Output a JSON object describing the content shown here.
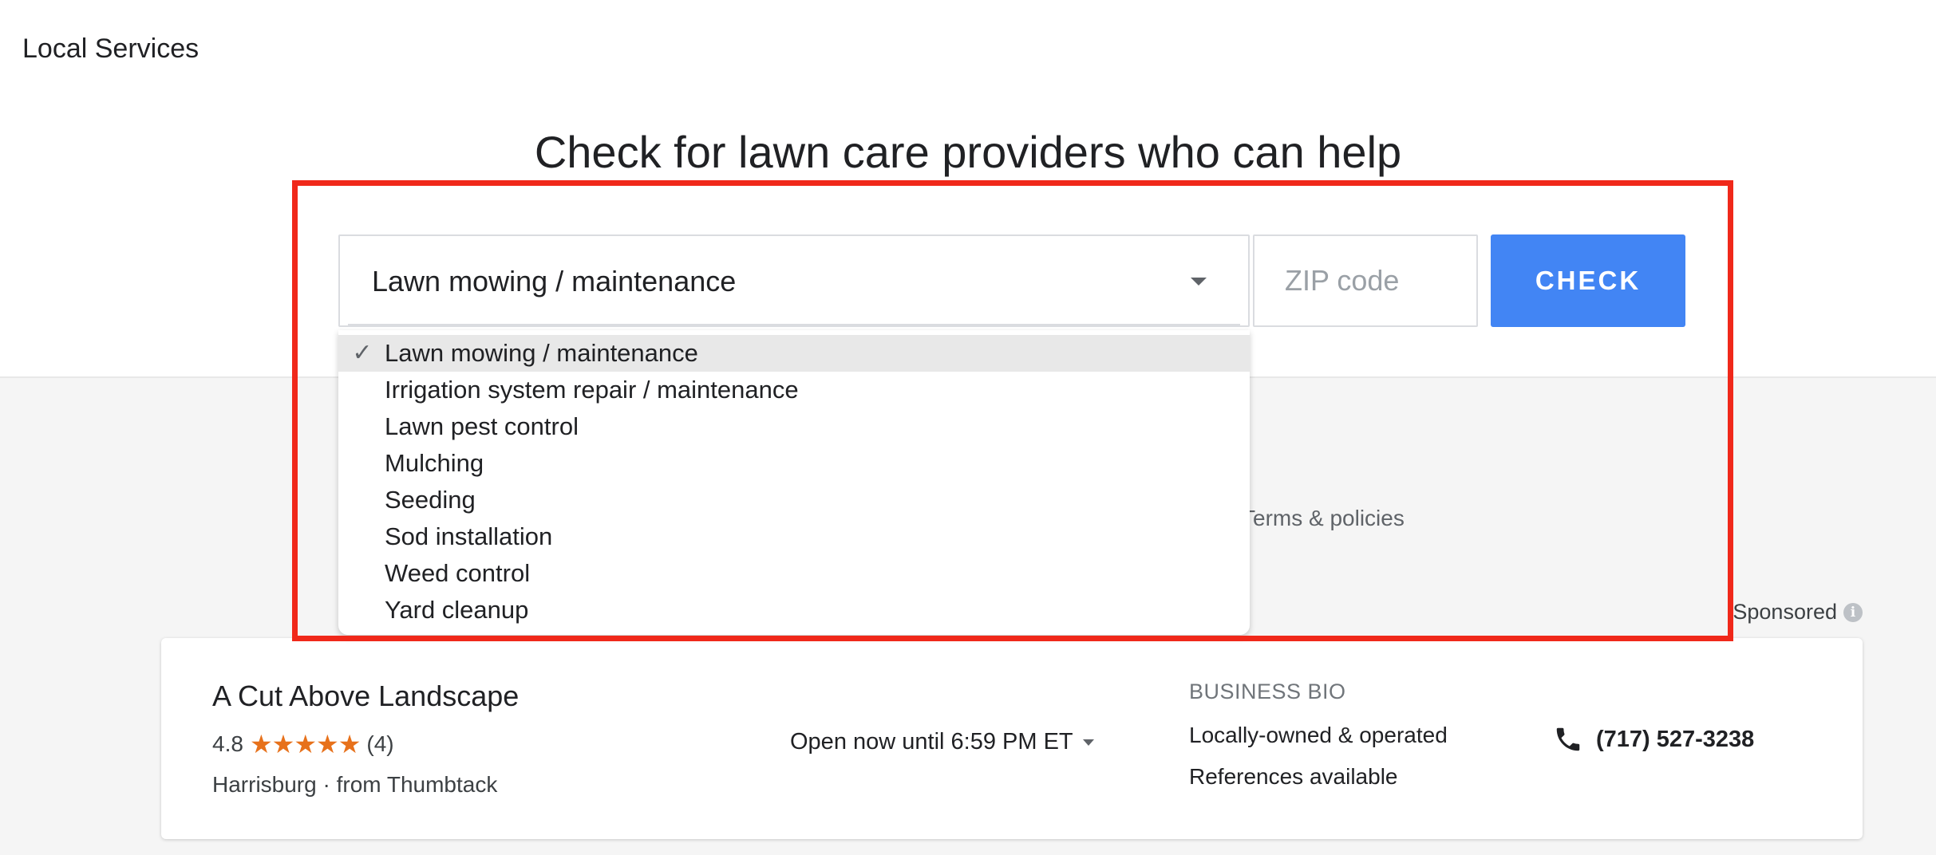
{
  "header": {
    "title": "Local Services"
  },
  "search": {
    "headline": "Check for lawn care providers who can help",
    "selected_service": "Lawn mowing / maintenance",
    "zip_placeholder": "ZIP code",
    "zip_value": "",
    "check_label": "CHECK"
  },
  "dropdown": {
    "options": [
      "Lawn mowing / maintenance",
      "Irrigation system repair / maintenance",
      "Lawn pest control",
      "Mulching",
      "Seeding",
      "Sod installation",
      "Weed control",
      "Yard cleanup"
    ],
    "check_glyph": "✓"
  },
  "terms_link": "Terms & policies",
  "sponsored": {
    "label": "Sponsored",
    "info_glyph": "i"
  },
  "listing": {
    "name": "A Cut Above Landscape",
    "rating": "4.8",
    "stars": "★★★★★",
    "review_count": "(4)",
    "location": "Harrisburg · from Thumbtack",
    "hours": "Open now until 6:59 PM ET",
    "bio_heading": "BUSINESS BIO",
    "bio_lines": [
      "Locally-owned & operated",
      "References available"
    ],
    "phone": "(717) 527-3238"
  },
  "colors": {
    "accent": "#4285f4",
    "highlight_border": "#f0281a",
    "star": "#e7711b"
  }
}
